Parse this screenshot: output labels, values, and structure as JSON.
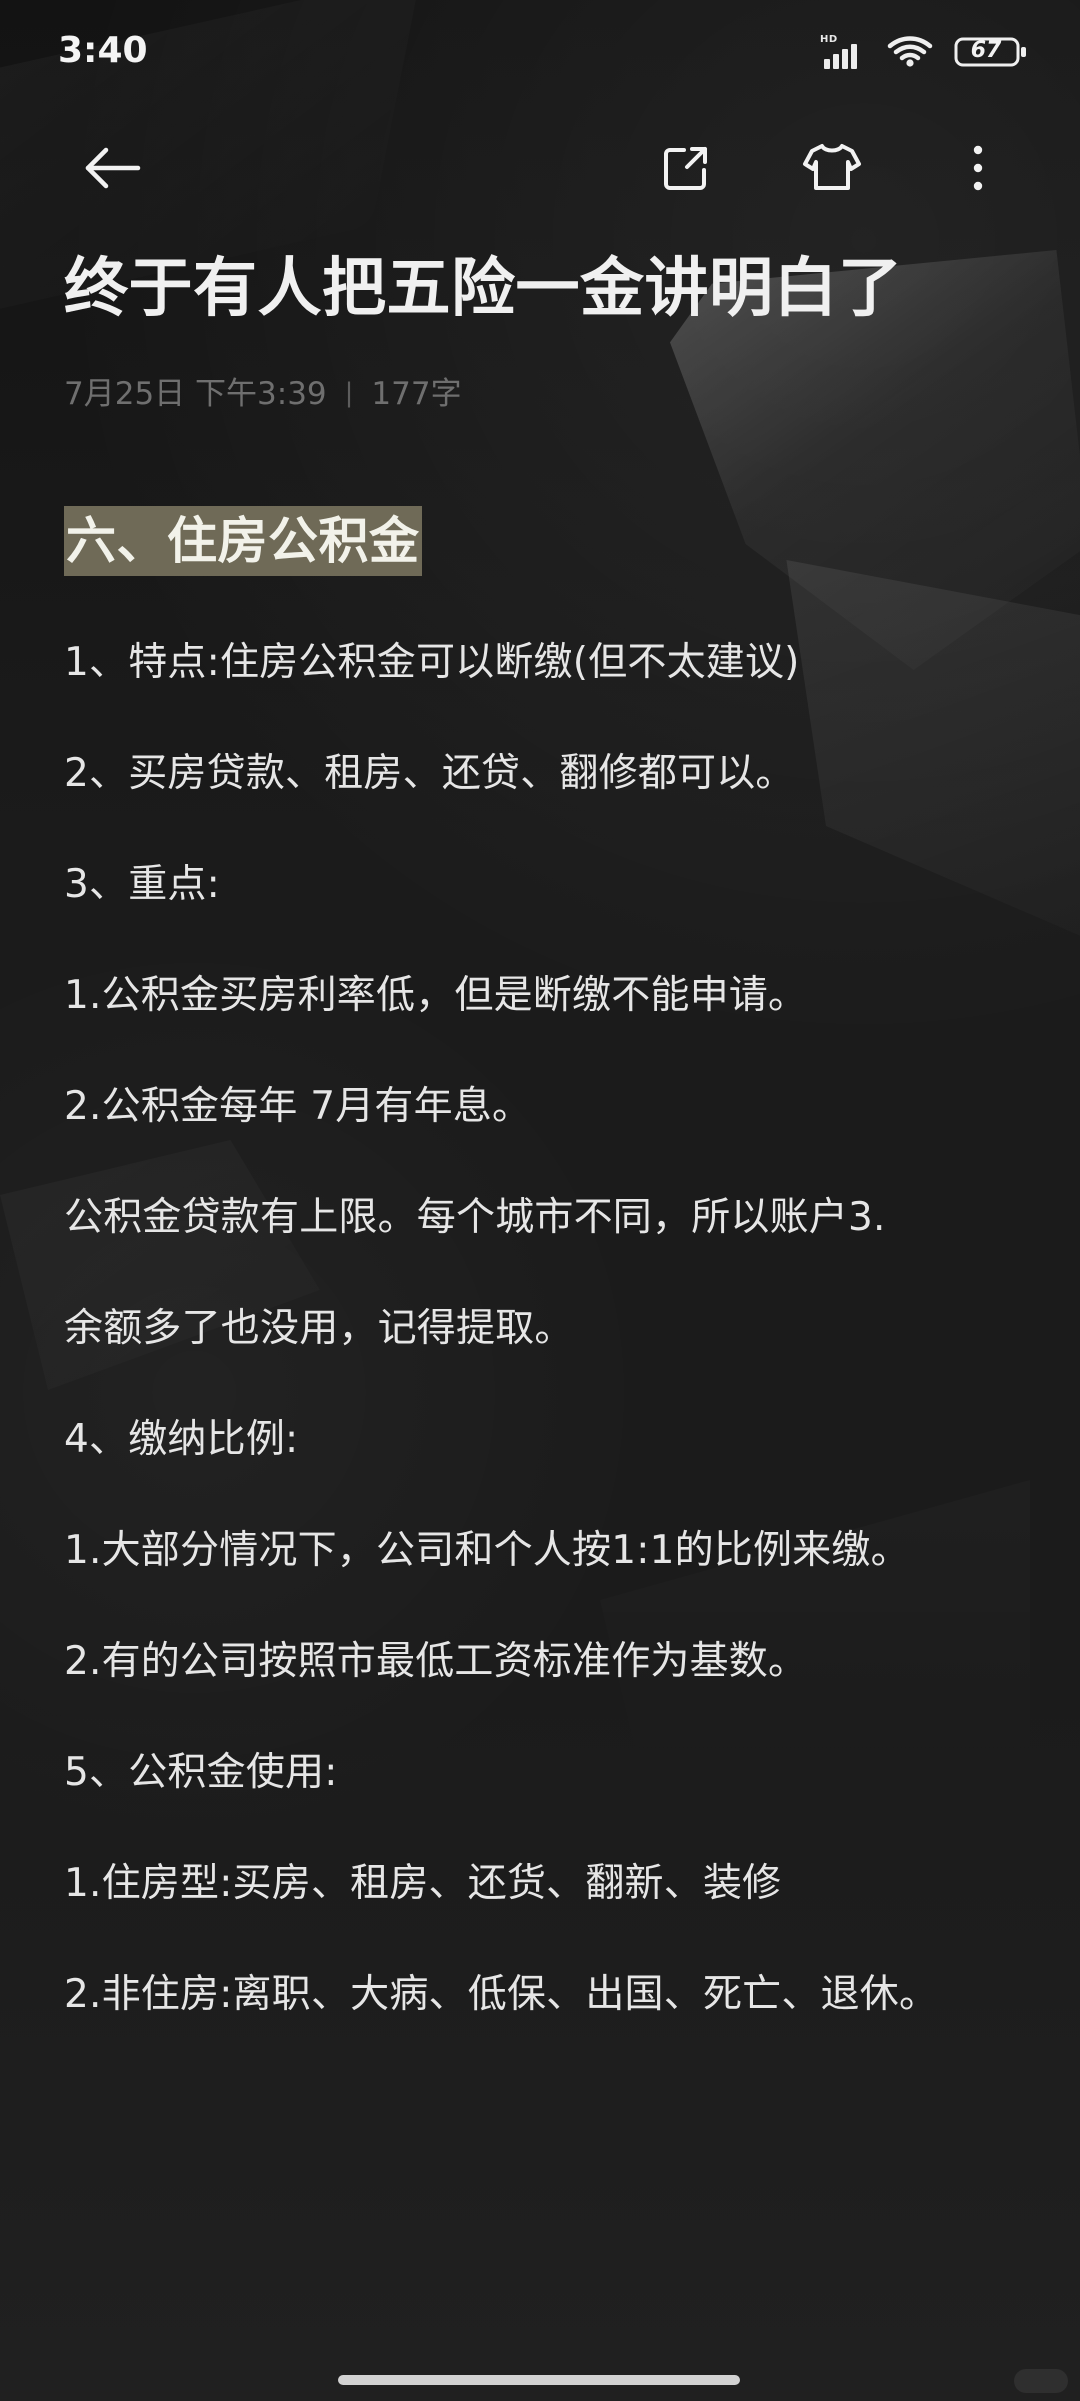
{
  "status_bar": {
    "time": "3:40",
    "network_badge": "HD",
    "battery": "67"
  },
  "toolbar": {
    "back_icon": "back-arrow-icon",
    "share_icon": "share-icon",
    "theme_icon": "shirt-icon",
    "more_icon": "more-vertical-icon"
  },
  "note": {
    "title": "终于有人把五险一金讲明白了",
    "date": "7月25日 下午3:39",
    "separator": "|",
    "word_count": "177字",
    "section_heading": "六、住房公积金",
    "lines": [
      "1、特点:住房公积金可以断缴(但不太建议)",
      "2、买房贷款、租房、还贷、翻修都可以。",
      "3、重点:",
      "1.公积金买房利率低，但是断缴不能申请。",
      "2.公积金每年 7月有年息。",
      "公积金贷款有上限。每个城市不同，所以账户3.",
      "余额多了也没用，记得提取。",
      "4、缴纳比例:",
      "1.大部分情况下，公司和个人按1:1的比例来缴。",
      "2.有的公司按照市最低工资标准作为基数。",
      "5、公积金使用:",
      "1.住房型:买房、租房、还货、翻新、装修",
      "2.非住房:离职、大病、低保、出国、死亡、退休。"
    ]
  },
  "theme": {
    "background": "#1b1b1b",
    "text": "#e6e6e6",
    "muted": "#6f6f6f",
    "highlight": "#6f6a57"
  }
}
